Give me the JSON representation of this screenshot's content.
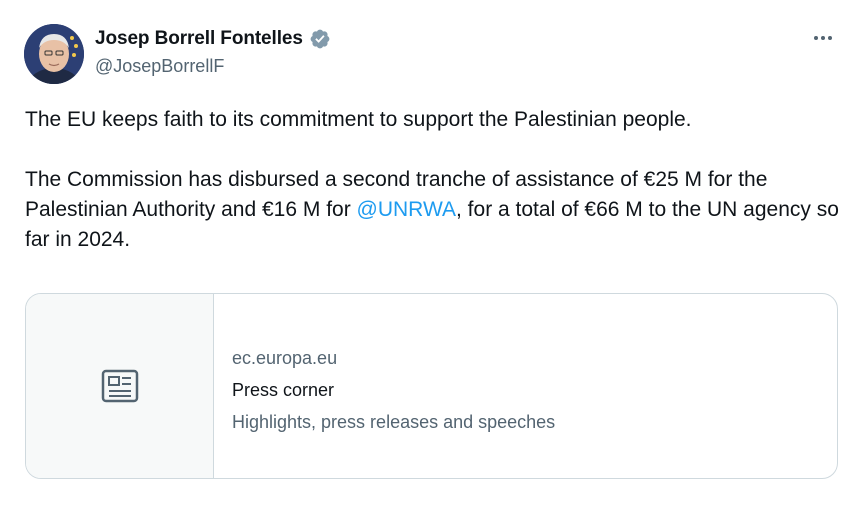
{
  "author": {
    "display_name": "Josep Borrell Fontelles",
    "handle": "@JosepBorrellF",
    "verified_icon": "verified-badge-icon",
    "verified_color": "#829aab"
  },
  "menu": {
    "more_icon": "more-options-icon"
  },
  "tweet": {
    "paragraph_1": "The EU keeps faith to its commitment to support the Palestinian people.",
    "paragraph_2_before": "The Commission has disbursed a second tranche of assistance of €25 M for the Palestinian Authority and €16 M for ",
    "mention": "@UNRWA",
    "paragraph_2_after": ", for a total of €66 M to the UN agency so far in 2024.",
    "mention_color": "#1d9bf0"
  },
  "link_card": {
    "icon": "article-icon",
    "domain": "ec.europa.eu",
    "title": "Press corner",
    "description": "Highlights, press releases and speeches"
  }
}
